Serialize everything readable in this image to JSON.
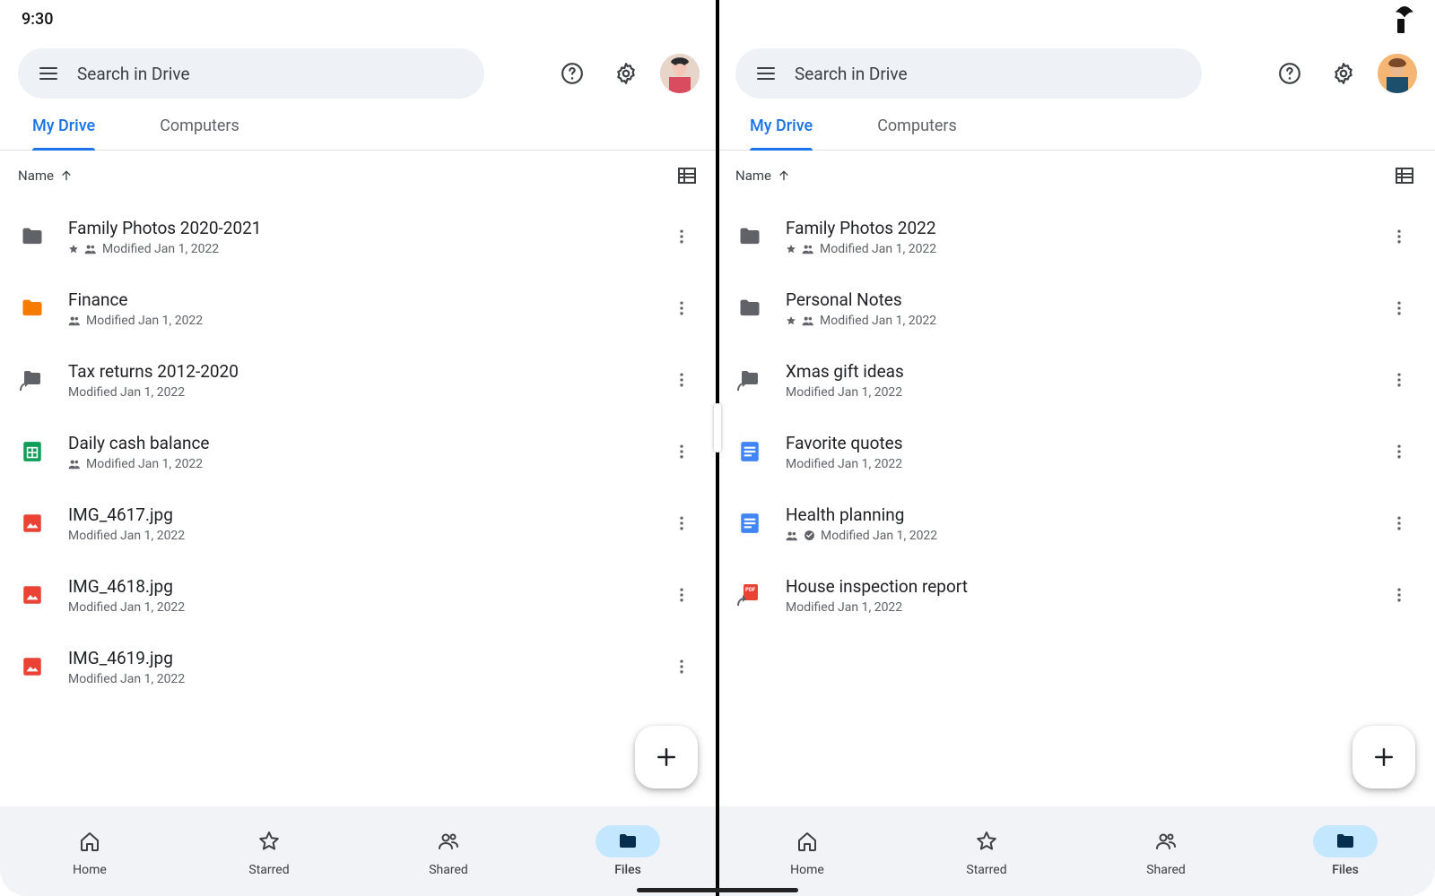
{
  "status": {
    "time": "9:30"
  },
  "search": {
    "placeholder": "Search in Drive"
  },
  "tabs": {
    "my_drive": "My Drive",
    "computers": "Computers"
  },
  "sort": {
    "label": "Name"
  },
  "panes": [
    {
      "files": [
        {
          "icon": "folder-grey",
          "name": "Family Photos 2020-2021",
          "starred": true,
          "shared": true,
          "modified": "Modified Jan 1, 2022"
        },
        {
          "icon": "folder-orange",
          "name": "Finance",
          "starred": false,
          "shared": true,
          "modified": "Modified Jan 1, 2022"
        },
        {
          "icon": "folder-shortcut",
          "name": "Tax returns 2012-2020",
          "starred": false,
          "shared": false,
          "modified": "Modified Jan 1, 2022"
        },
        {
          "icon": "sheet",
          "name": "Daily cash balance",
          "starred": false,
          "shared": true,
          "modified": "Modified Jan 1, 2022"
        },
        {
          "icon": "image",
          "name": "IMG_4617.jpg",
          "starred": false,
          "shared": false,
          "modified": "Modified Jan 1, 2022"
        },
        {
          "icon": "image",
          "name": "IMG_4618.jpg",
          "starred": false,
          "shared": false,
          "modified": "Modified Jan 1, 2022"
        },
        {
          "icon": "image",
          "name": "IMG_4619.jpg",
          "starred": false,
          "shared": false,
          "modified": "Modified Jan 1, 2022"
        }
      ]
    },
    {
      "files": [
        {
          "icon": "folder-grey",
          "name": "Family Photos 2022",
          "starred": true,
          "shared": true,
          "modified": "Modified Jan 1, 2022"
        },
        {
          "icon": "folder-grey",
          "name": "Personal Notes",
          "starred": true,
          "shared": true,
          "modified": "Modified Jan 1, 2022"
        },
        {
          "icon": "folder-shortcut",
          "name": "Xmas gift ideas",
          "starred": false,
          "shared": false,
          "modified": "Modified Jan 1, 2022"
        },
        {
          "icon": "doc",
          "name": "Favorite quotes",
          "starred": false,
          "shared": false,
          "modified": "Modified Jan 1, 2022"
        },
        {
          "icon": "doc",
          "name": "Health planning",
          "starred": false,
          "shared": true,
          "synced": true,
          "modified": "Modified Jan 1, 2022"
        },
        {
          "icon": "pdf-shortcut",
          "name": "House inspection report",
          "starred": false,
          "shared": false,
          "modified": "Modified Jan 1, 2022"
        }
      ]
    }
  ],
  "nav": {
    "home": "Home",
    "starred": "Starred",
    "shared": "Shared",
    "files": "Files"
  }
}
